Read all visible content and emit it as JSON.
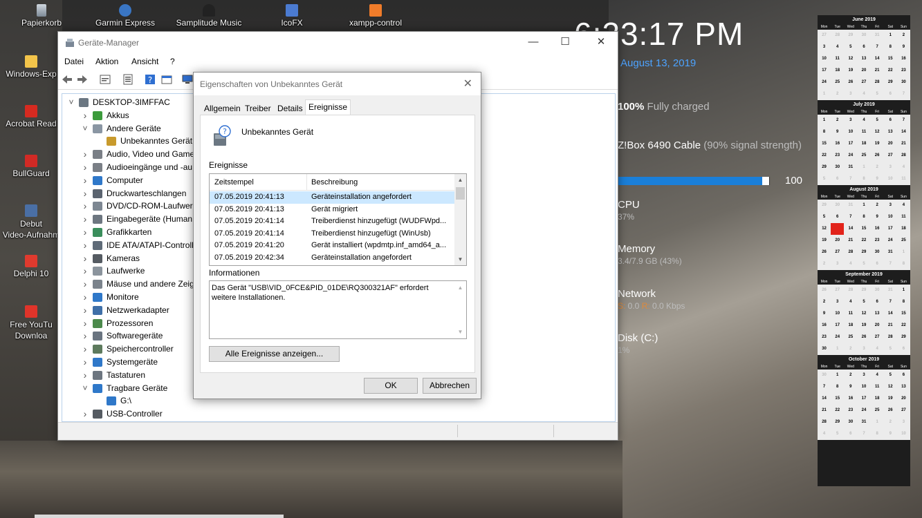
{
  "desktop_icons": {
    "top": [
      {
        "label": "Papierkorb",
        "icon": "recycle-bin-icon"
      },
      {
        "label": "Garmin Express",
        "icon": "garmin-icon"
      },
      {
        "label": "Samplitude Music",
        "icon": "samplitude-icon"
      },
      {
        "label": "IcoFX",
        "icon": "icofx-icon"
      },
      {
        "label": "xampp-control",
        "icon": "xampp-icon"
      }
    ],
    "left": [
      {
        "label": "Windows-Exp",
        "icon": "explorer-icon"
      },
      {
        "label": "Acrobat Read",
        "icon": "acrobat-icon"
      },
      {
        "label": "BullGuard",
        "icon": "bullguard-icon"
      },
      {
        "label": "Debut Video-Aufnahm",
        "label1": "Debut",
        "label2": "Video-Aufnahm",
        "icon": "debut-icon"
      },
      {
        "label": "Delphi 10",
        "icon": "delphi-icon"
      },
      {
        "label": "Free YouTu Downloa",
        "label1": "Free YouTu",
        "label2": "Downloa",
        "icon": "youtube-downloader-icon"
      }
    ]
  },
  "widgets": {
    "clock": "6:23:17 PM",
    "date": "August 13, 2019",
    "battery": {
      "percent": "100%",
      "status": "Fully charged"
    },
    "wifi": {
      "name": "Z!Box 6490 Cable",
      "signal": "(90% signal strength)"
    },
    "volume": {
      "value": "100",
      "level": 1.0
    },
    "cpu": {
      "label": "CPU",
      "value": "37%"
    },
    "memory": {
      "label": "Memory",
      "value": "3.4/7.9 GB (43%)"
    },
    "network": {
      "label": "Network",
      "s_label": "S:",
      "s_value": " 0.0 ",
      "r_label": "R:",
      "r_value": " 0.0 Kbps"
    },
    "disk": {
      "label": "Disk (C:)",
      "value": "1%"
    }
  },
  "calendar": {
    "weekday_headers": [
      "Mon",
      "Tue",
      "Wed",
      "Thu",
      "Fri",
      "Sat",
      "Sun"
    ],
    "months": [
      {
        "title": "June 2019",
        "days": [
          "27",
          "28",
          "29",
          "30",
          "31",
          "1",
          "2",
          "3",
          "4",
          "5",
          "6",
          "7",
          "8",
          "9",
          "10",
          "11",
          "12",
          "13",
          "14",
          "15",
          "16",
          "17",
          "18",
          "19",
          "20",
          "21",
          "22",
          "23",
          "24",
          "25",
          "26",
          "27",
          "28",
          "29",
          "30",
          "1",
          "2",
          "3",
          "4",
          "5",
          "6",
          "7"
        ],
        "first_in": 5,
        "last_in": 34
      },
      {
        "title": "July 2019",
        "days": [
          "1",
          "2",
          "3",
          "4",
          "5",
          "6",
          "7",
          "8",
          "9",
          "10",
          "11",
          "12",
          "13",
          "14",
          "15",
          "16",
          "17",
          "18",
          "19",
          "20",
          "21",
          "22",
          "23",
          "24",
          "25",
          "26",
          "27",
          "28",
          "29",
          "30",
          "31",
          "1",
          "2",
          "3",
          "4",
          "5",
          "6",
          "7",
          "8",
          "9",
          "10",
          "11"
        ],
        "first_in": 0,
        "last_in": 30
      },
      {
        "title": "August 2019",
        "days": [
          "29",
          "30",
          "31",
          "1",
          "2",
          "3",
          "4",
          "5",
          "6",
          "7",
          "8",
          "9",
          "10",
          "11",
          "12",
          "13",
          "14",
          "15",
          "16",
          "17",
          "18",
          "19",
          "20",
          "21",
          "22",
          "23",
          "24",
          "25",
          "26",
          "27",
          "28",
          "29",
          "30",
          "31",
          "1",
          "2",
          "3",
          "4",
          "5",
          "6",
          "7",
          "8"
        ],
        "first_in": 3,
        "last_in": 33,
        "today": 15
      },
      {
        "title": "September 2019",
        "days": [
          "26",
          "27",
          "28",
          "29",
          "30",
          "31",
          "1",
          "2",
          "3",
          "4",
          "5",
          "6",
          "7",
          "8",
          "9",
          "10",
          "11",
          "12",
          "13",
          "14",
          "15",
          "16",
          "17",
          "18",
          "19",
          "20",
          "21",
          "22",
          "23",
          "24",
          "25",
          "26",
          "27",
          "28",
          "29",
          "30",
          "1",
          "2",
          "3",
          "4",
          "5",
          "6"
        ],
        "first_in": 6,
        "last_in": 35
      },
      {
        "title": "October 2019",
        "days": [
          "30",
          "1",
          "2",
          "3",
          "4",
          "5",
          "6",
          "7",
          "8",
          "9",
          "10",
          "11",
          "12",
          "13",
          "14",
          "15",
          "16",
          "17",
          "18",
          "19",
          "20",
          "21",
          "22",
          "23",
          "24",
          "25",
          "26",
          "27",
          "28",
          "29",
          "30",
          "31",
          "1",
          "2",
          "3",
          "4",
          "5",
          "6",
          "7",
          "8",
          "9",
          "10"
        ],
        "first_in": 1,
        "last_in": 31
      }
    ]
  },
  "device_manager": {
    "title": "Geräte-Manager",
    "menu": [
      "Datei",
      "Aktion",
      "Ansicht",
      "?"
    ],
    "tree": [
      {
        "label": "DESKTOP-3IMFFAC",
        "level": 0,
        "expander": "v",
        "icon": "computer-icon"
      },
      {
        "label": "Akkus",
        "level": 1,
        "expander": ">",
        "icon": "battery-icon"
      },
      {
        "label": "Andere Geräte",
        "level": 1,
        "expander": "v",
        "icon": "unknown-device-icon"
      },
      {
        "label": "Unbekanntes Gerät",
        "level": 2,
        "expander": "",
        "icon": "warning-device-icon"
      },
      {
        "label": "Audio, Video und Game",
        "level": 1,
        "expander": ">",
        "icon": "speaker-icon"
      },
      {
        "label": "Audioeingänge und -au",
        "level": 1,
        "expander": ">",
        "icon": "speaker-icon"
      },
      {
        "label": "Computer",
        "level": 1,
        "expander": ">",
        "icon": "monitor-icon"
      },
      {
        "label": "Druckwarteschlangen",
        "level": 1,
        "expander": ">",
        "icon": "printer-icon"
      },
      {
        "label": "DVD/CD-ROM-Laufwerk",
        "level": 1,
        "expander": ">",
        "icon": "disc-drive-icon"
      },
      {
        "label": "Eingabegeräte (Human",
        "level": 1,
        "expander": ">",
        "icon": "keyboard-icon"
      },
      {
        "label": "Grafikkarten",
        "level": 1,
        "expander": ">",
        "icon": "display-adapter-icon"
      },
      {
        "label": "IDE ATA/ATAPI-Controlle",
        "level": 1,
        "expander": ">",
        "icon": "controller-icon"
      },
      {
        "label": "Kameras",
        "level": 1,
        "expander": ">",
        "icon": "camera-icon"
      },
      {
        "label": "Laufwerke",
        "level": 1,
        "expander": ">",
        "icon": "drive-icon"
      },
      {
        "label": "Mäuse und andere Zeig",
        "level": 1,
        "expander": ">",
        "icon": "mouse-icon"
      },
      {
        "label": "Monitore",
        "level": 1,
        "expander": ">",
        "icon": "monitor-icon"
      },
      {
        "label": "Netzwerkadapter",
        "level": 1,
        "expander": ">",
        "icon": "network-adapter-icon"
      },
      {
        "label": "Prozessoren",
        "level": 1,
        "expander": ">",
        "icon": "processor-icon"
      },
      {
        "label": "Softwaregeräte",
        "level": 1,
        "expander": ">",
        "icon": "software-device-icon"
      },
      {
        "label": "Speichercontroller",
        "level": 1,
        "expander": ">",
        "icon": "storage-controller-icon"
      },
      {
        "label": "Systemgeräte",
        "level": 1,
        "expander": ">",
        "icon": "system-device-icon"
      },
      {
        "label": "Tastaturen",
        "level": 1,
        "expander": ">",
        "icon": "keyboard-icon"
      },
      {
        "label": "Tragbare Geräte",
        "level": 1,
        "expander": "v",
        "icon": "portable-device-icon"
      },
      {
        "label": "G:\\",
        "level": 2,
        "expander": "",
        "icon": "portable-device-icon"
      },
      {
        "label": "USB-Controller",
        "level": 1,
        "expander": ">",
        "icon": "usb-icon"
      }
    ]
  },
  "dialog": {
    "title": "Eigenschaften von Unbekanntes Gerät",
    "tabs": [
      "Allgemein",
      "Treiber",
      "Details",
      "Ereignisse"
    ],
    "active_tab": "Ereignisse",
    "device_name": "Unbekanntes Gerät",
    "events_label": "Ereignisse",
    "columns": [
      "Zeitstempel",
      "Beschreibung"
    ],
    "events": [
      {
        "time": "07.05.2019 20:41:13",
        "desc": "Geräteinstallation angefordert"
      },
      {
        "time": "07.05.2019 20:41:13",
        "desc": "Gerät migriert"
      },
      {
        "time": "07.05.2019 20:41:14",
        "desc": "Treiberdienst hinzugefügt (WUDFWpd..."
      },
      {
        "time": "07.05.2019 20:41:14",
        "desc": "Treiberdienst hinzugefügt (WinUsb)"
      },
      {
        "time": "07.05.2019 20:41:20",
        "desc": "Gerät installiert (wpdmtp.inf_amd64_a..."
      },
      {
        "time": "07.05.2019 20:42:34",
        "desc": "Geräteinstallation angefordert"
      }
    ],
    "info_label": "Informationen",
    "info_text": "Das Gerät \"USB\\VID_0FCE&PID_01DE\\RQ300321AF\" erfordert weitere Installationen.",
    "show_all_button": "Alle Ereignisse anzeigen...",
    "ok_button": "OK",
    "cancel_button": "Abbrechen"
  }
}
